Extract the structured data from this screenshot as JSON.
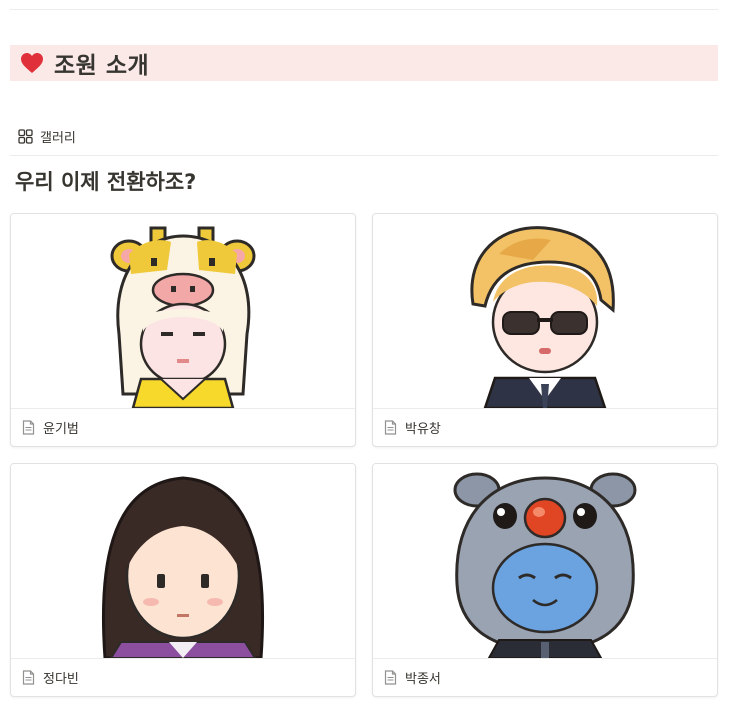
{
  "callout": {
    "icon": "heart-icon",
    "title": "조원 소개",
    "background": "#fbe9e8",
    "icon_color": "#e0303a"
  },
  "view": {
    "icon": "gallery-grid-icon",
    "label": "갤러리"
  },
  "database": {
    "title": "우리 이제 전환하조?"
  },
  "cards": [
    {
      "name": "윤기범",
      "icon": "page-icon",
      "cover": "cow-hood-avatar"
    },
    {
      "name": "박유창",
      "icon": "page-icon",
      "cover": "blonde-sunglasses-avatar"
    },
    {
      "name": "정다빈",
      "icon": "page-icon",
      "cover": "long-hair-avatar"
    },
    {
      "name": "박종서",
      "icon": "page-icon",
      "cover": "reindeer-hood-avatar"
    }
  ]
}
